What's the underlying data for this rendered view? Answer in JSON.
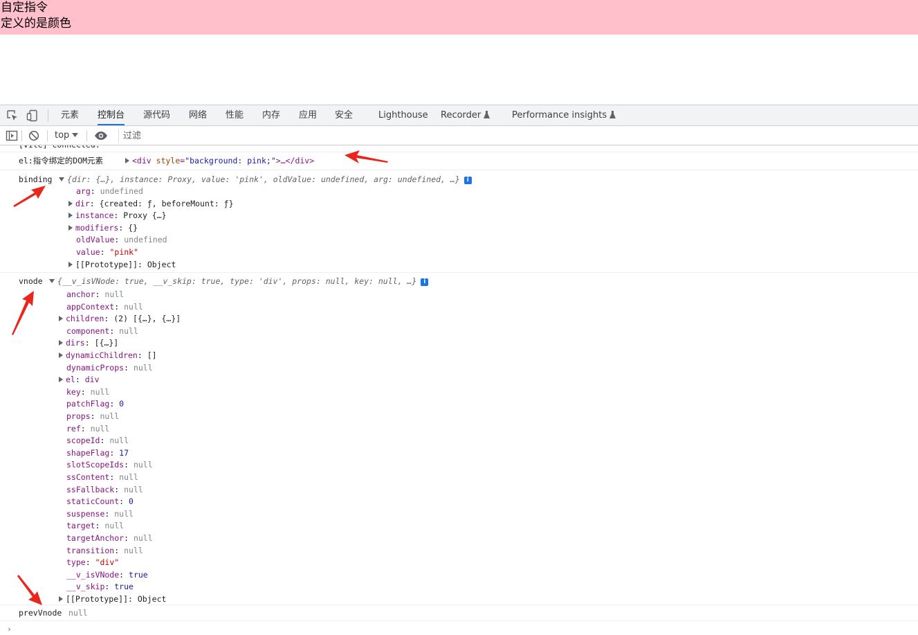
{
  "page": {
    "line1": "自定指令",
    "line2": "定义的是颜色",
    "banner_color": "#ffc0cb"
  },
  "devtools": {
    "icons": {
      "inspect": "inspect-element-icon",
      "device": "device-toolbar-icon"
    },
    "tabs": [
      {
        "label": "元素",
        "active": false
      },
      {
        "label": "控制台",
        "active": true
      },
      {
        "label": "源代码",
        "active": false
      },
      {
        "label": "网络",
        "active": false
      },
      {
        "label": "性能",
        "active": false
      },
      {
        "label": "内存",
        "active": false
      },
      {
        "label": "应用",
        "active": false
      },
      {
        "label": "安全",
        "active": false
      },
      {
        "label": "Lighthouse",
        "active": false
      },
      {
        "label": "Recorder",
        "active": false
      },
      {
        "label": "Performance insights",
        "active": false
      }
    ],
    "toolbar": {
      "context": "top",
      "filter_placeholder": "过滤"
    }
  },
  "console": {
    "clipped_line": "[vite] connected.",
    "el_msg": {
      "label": "el:指令绑定的DOM元素",
      "tag_open": "<div",
      "attr_name": "style",
      "attr_value": "\"background: pink;\"",
      "tag_rest": ">…</div>"
    },
    "binding": {
      "label": "binding",
      "preview": "{dir: {…}, instance: Proxy, value: 'pink', oldValue: undefined, arg: undefined, …}",
      "props": [
        {
          "key": "arg",
          "value": "undefined",
          "expandable": false,
          "kind": "null"
        },
        {
          "key": "dir",
          "value": "{created: ƒ, beforeMount: ƒ}",
          "expandable": true,
          "kind": "obj"
        },
        {
          "key": "instance",
          "value": "Proxy {…}",
          "expandable": true,
          "kind": "obj"
        },
        {
          "key": "modifiers",
          "value": "{}",
          "expandable": true,
          "kind": "obj"
        },
        {
          "key": "oldValue",
          "value": "undefined",
          "expandable": false,
          "kind": "null"
        },
        {
          "key": "value",
          "value": "\"pink\"",
          "expandable": false,
          "kind": "str"
        },
        {
          "key": "[[Prototype]]",
          "value": "Object",
          "expandable": true,
          "kind": "obj"
        }
      ]
    },
    "vnode": {
      "label": "vnode",
      "preview": "{__v_isVNode: true, __v_skip: true, type: 'div', props: null, key: null, …}",
      "props": [
        {
          "key": "anchor",
          "value": "null",
          "expandable": false,
          "kind": "null"
        },
        {
          "key": "appContext",
          "value": "null",
          "expandable": false,
          "kind": "null"
        },
        {
          "key": "children",
          "value": "(2) [{…}, {…}]",
          "expandable": true,
          "kind": "obj"
        },
        {
          "key": "component",
          "value": "null",
          "expandable": false,
          "kind": "null"
        },
        {
          "key": "dirs",
          "value": "[{…}]",
          "expandable": true,
          "kind": "obj"
        },
        {
          "key": "dynamicChildren",
          "value": "[]",
          "expandable": true,
          "kind": "obj"
        },
        {
          "key": "dynamicProps",
          "value": "null",
          "expandable": false,
          "kind": "null"
        },
        {
          "key": "el",
          "value": "div",
          "expandable": true,
          "kind": "tag"
        },
        {
          "key": "key",
          "value": "null",
          "expandable": false,
          "kind": "null"
        },
        {
          "key": "patchFlag",
          "value": "0",
          "expandable": false,
          "kind": "num"
        },
        {
          "key": "props",
          "value": "null",
          "expandable": false,
          "kind": "null"
        },
        {
          "key": "ref",
          "value": "null",
          "expandable": false,
          "kind": "null"
        },
        {
          "key": "scopeId",
          "value": "null",
          "expandable": false,
          "kind": "null"
        },
        {
          "key": "shapeFlag",
          "value": "17",
          "expandable": false,
          "kind": "num"
        },
        {
          "key": "slotScopeIds",
          "value": "null",
          "expandable": false,
          "kind": "null"
        },
        {
          "key": "ssContent",
          "value": "null",
          "expandable": false,
          "kind": "null"
        },
        {
          "key": "ssFallback",
          "value": "null",
          "expandable": false,
          "kind": "null"
        },
        {
          "key": "staticCount",
          "value": "0",
          "expandable": false,
          "kind": "num"
        },
        {
          "key": "suspense",
          "value": "null",
          "expandable": false,
          "kind": "null"
        },
        {
          "key": "target",
          "value": "null",
          "expandable": false,
          "kind": "null"
        },
        {
          "key": "targetAnchor",
          "value": "null",
          "expandable": false,
          "kind": "null"
        },
        {
          "key": "transition",
          "value": "null",
          "expandable": false,
          "kind": "null"
        },
        {
          "key": "type",
          "value": "\"div\"",
          "expandable": false,
          "kind": "str"
        },
        {
          "key": "__v_isVNode",
          "value": "true",
          "expandable": false,
          "kind": "bool"
        },
        {
          "key": "__v_skip",
          "value": "true",
          "expandable": false,
          "kind": "bool"
        },
        {
          "key": "[[Prototype]]",
          "value": "Object",
          "expandable": true,
          "kind": "obj"
        }
      ]
    },
    "prevVnode": {
      "label": "prevVnode",
      "value": "null"
    },
    "prompt": "›",
    "annotation_color": "#e8261c"
  }
}
